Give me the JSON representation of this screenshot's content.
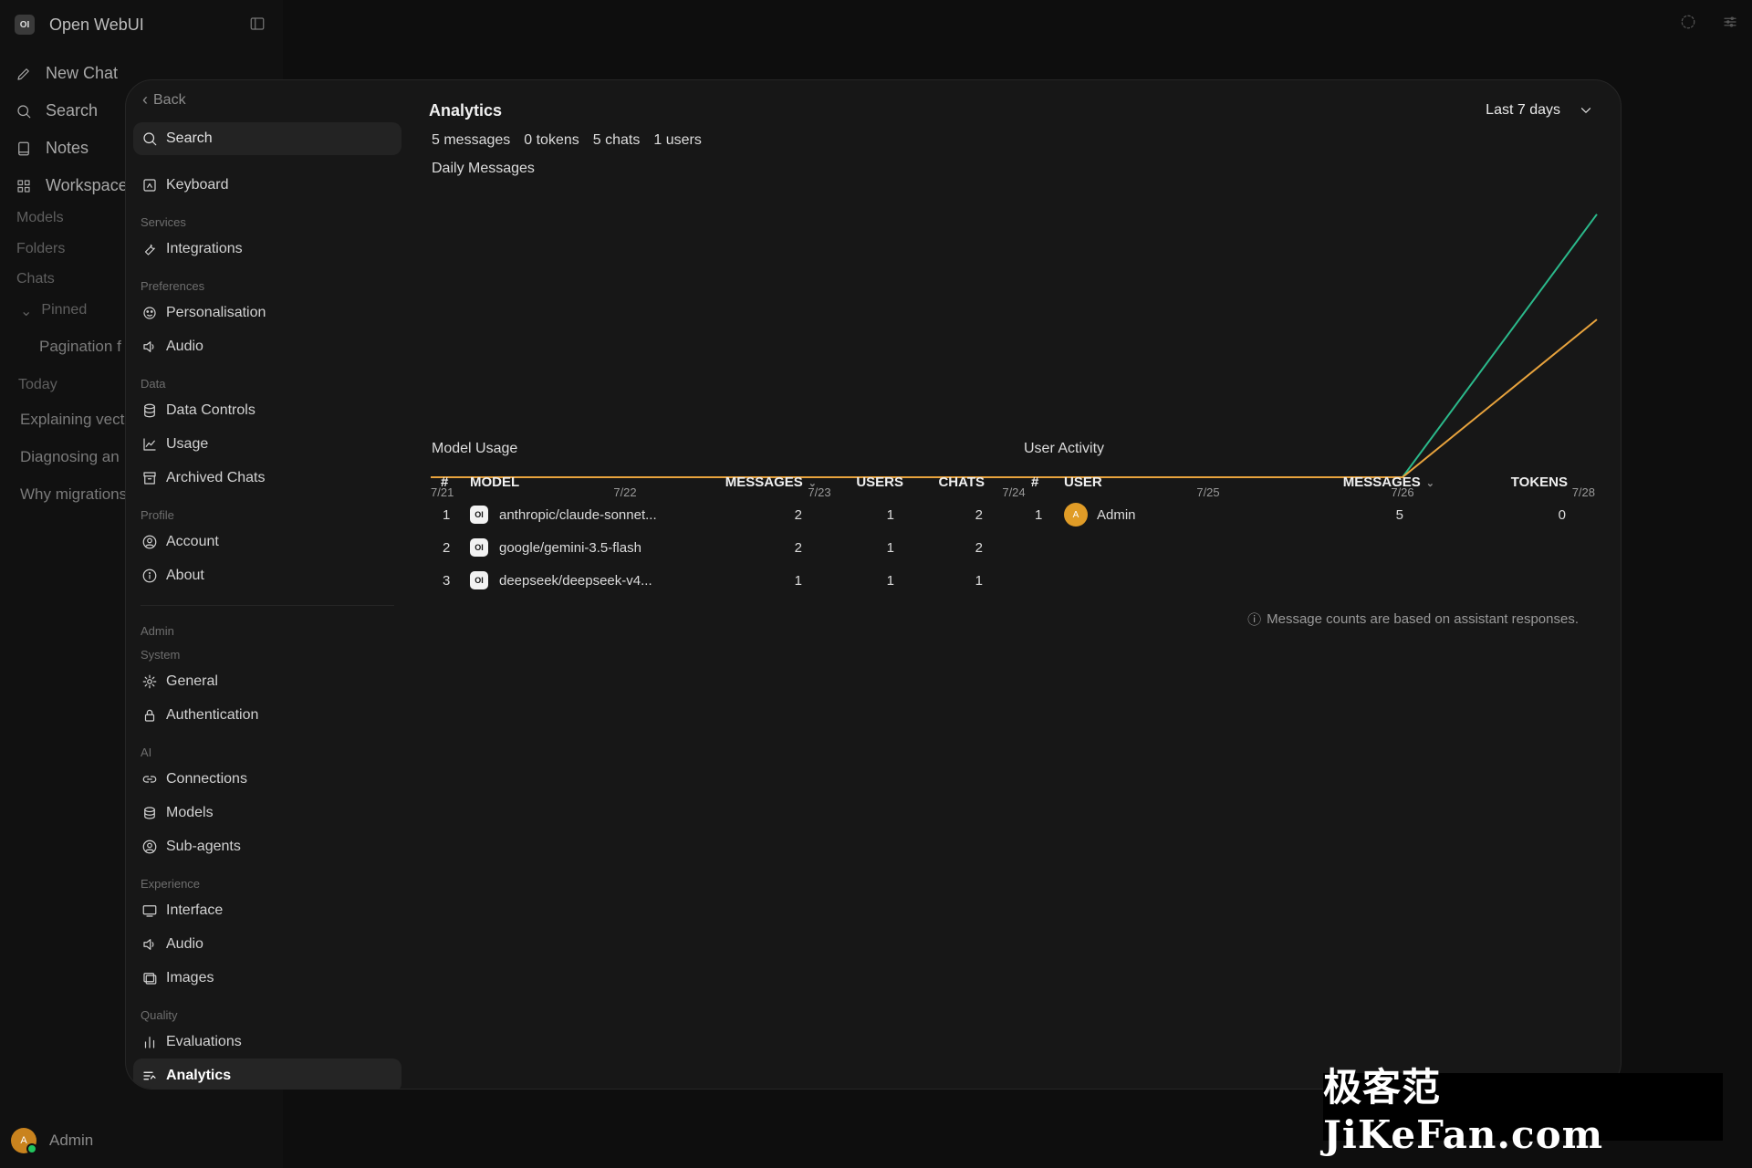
{
  "app": {
    "title": "Open WebUI",
    "logo": "OI"
  },
  "sidebar": {
    "nav": [
      {
        "label": "New Chat",
        "icon": "pencil-icon"
      },
      {
        "label": "Search",
        "icon": "search-icon"
      },
      {
        "label": "Notes",
        "icon": "note-icon"
      },
      {
        "label": "Workspace",
        "icon": "grid-icon"
      }
    ],
    "sections": {
      "models": "Models",
      "folders": "Folders",
      "chats": "Chats",
      "pinned": "Pinned",
      "today": "Today"
    },
    "pinned_chats": [
      "Pagination f"
    ],
    "today_chats": [
      "Explaining vect",
      "Diagnosing an",
      "Why migrations"
    ],
    "user": {
      "name": "Admin",
      "initial": "A"
    }
  },
  "settings": {
    "back_label": "Back",
    "search_label": "Search",
    "keyboard": "Keyboard",
    "groups": {
      "services": "Services",
      "preferences": "Preferences",
      "data": "Data",
      "profile": "Profile",
      "admin": "Admin",
      "system": "System",
      "ai": "AI",
      "experience": "Experience",
      "quality": "Quality"
    },
    "items": {
      "integrations": "Integrations",
      "personalisation": "Personalisation",
      "audio": "Audio",
      "data_controls": "Data Controls",
      "usage": "Usage",
      "archived_chats": "Archived Chats",
      "account": "Account",
      "about": "About",
      "general": "General",
      "authentication": "Authentication",
      "connections": "Connections",
      "models": "Models",
      "sub_agents": "Sub-agents",
      "interface": "Interface",
      "audio2": "Audio",
      "images": "Images",
      "evaluations": "Evaluations",
      "analytics": "Analytics"
    }
  },
  "analytics": {
    "title": "Analytics",
    "range": "Last 7 days",
    "stats": [
      "5 messages",
      "0 tokens",
      "5 chats",
      "1 users"
    ],
    "chart_title": "Daily Messages",
    "model_usage_title": "Model Usage",
    "user_activity_title": "User Activity",
    "model_columns": [
      "#",
      "Model",
      "Messages",
      "Users",
      "Chats"
    ],
    "model_rows": [
      {
        "rank": "1",
        "model": "anthropic/claude-sonnet...",
        "messages": "2",
        "users": "1",
        "chats": "2"
      },
      {
        "rank": "2",
        "model": "google/gemini-3.5-flash",
        "messages": "2",
        "users": "1",
        "chats": "2"
      },
      {
        "rank": "3",
        "model": "deepseek/deepseek-v4...",
        "messages": "1",
        "users": "1",
        "chats": "1"
      }
    ],
    "user_columns": [
      "#",
      "User",
      "Messages",
      "Tokens"
    ],
    "user_rows": [
      {
        "rank": "1",
        "user": "Admin",
        "initial": "A",
        "messages": "5",
        "tokens": "0"
      }
    ],
    "note": "Message counts are based on assistant responses."
  },
  "chart_data": {
    "type": "line",
    "x": [
      "7/21",
      "7/22",
      "7/23",
      "7/24",
      "7/25",
      "7/26",
      "7/28"
    ],
    "series": [
      {
        "color": "#2bb98b",
        "values": [
          0,
          0,
          0,
          0,
          0,
          0,
          5
        ]
      },
      {
        "color": "#e8a33d",
        "values": [
          0,
          0,
          0,
          0,
          0,
          0,
          3
        ]
      }
    ],
    "ylim": [
      0,
      5.5
    ]
  },
  "watermark": "极客范 JiKeFan.com",
  "colors": {
    "accent_green": "#2bb98b",
    "accent_orange": "#e8a33d",
    "avatar": "#e09c27"
  }
}
